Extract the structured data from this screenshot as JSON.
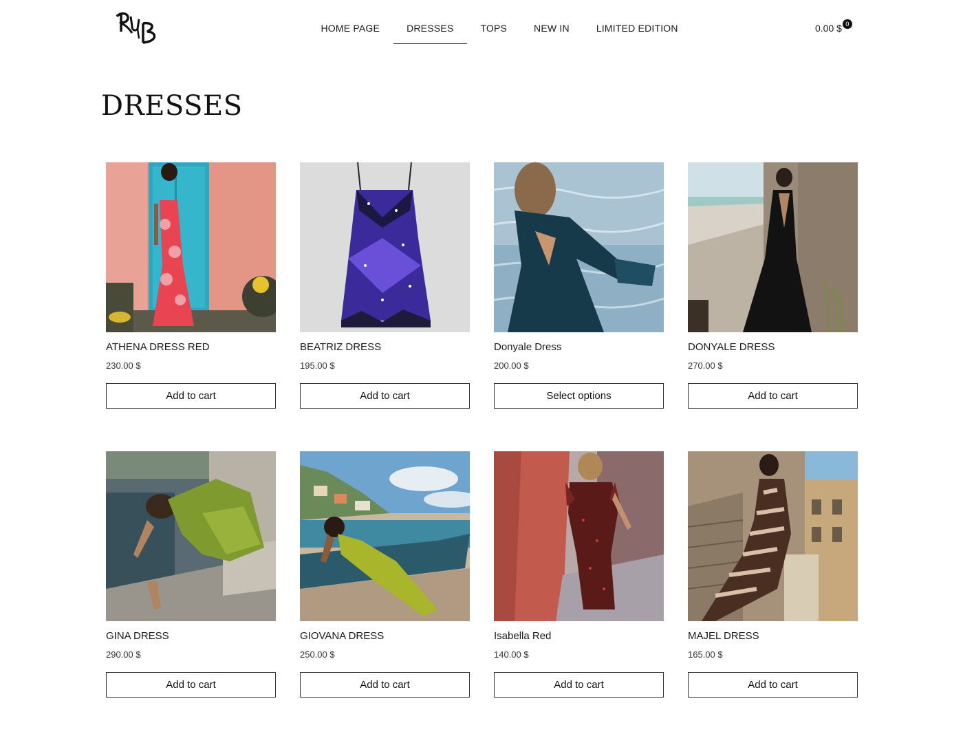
{
  "header": {
    "logo_text": "RB",
    "nav": [
      {
        "label": "HOME PAGE",
        "active": false
      },
      {
        "label": "DRESSES",
        "active": true
      },
      {
        "label": "TOPS",
        "active": false
      },
      {
        "label": "NEW IN",
        "active": false
      },
      {
        "label": "LIMITED EDITION",
        "active": false
      }
    ],
    "cart": {
      "total": "0.00 $",
      "count": "0"
    }
  },
  "page": {
    "title": "DRESSES"
  },
  "products": [
    {
      "title": "ATHENA DRESS RED",
      "price": "230.00 $",
      "button": "Add to cart",
      "image": "woman-red-floral-dress-turquoise-door"
    },
    {
      "title": "BEATRIZ DRESS",
      "price": "195.00 $",
      "button": "Add to cart",
      "image": "purple-butterfly-print-slip-dress"
    },
    {
      "title": "Donyale Dress",
      "price": "200.00 $",
      "button": "Select options",
      "image": "woman-dark-teal-dress-by-water"
    },
    {
      "title": "DONYALE DRESS",
      "price": "270.00 $",
      "button": "Add to cart",
      "image": "woman-black-halter-gown-wall"
    },
    {
      "title": "GINA DRESS",
      "price": "290.00 $",
      "button": "Add to cart",
      "image": "woman-green-sequin-dress-steps"
    },
    {
      "title": "GIOVANA DRESS",
      "price": "250.00 $",
      "button": "Add to cart",
      "image": "woman-lime-dress-boat-beach"
    },
    {
      "title": "Isabella Red",
      "price": "140.00 $",
      "button": "Add to cart",
      "image": "woman-red-print-dress-coral-wall"
    },
    {
      "title": "MAJEL DRESS",
      "price": "165.00 $",
      "button": "Add to cart",
      "image": "woman-zebra-print-dress-stairs"
    }
  ],
  "colors": {
    "text": "#1a1a1a",
    "border": "#333333",
    "background": "#ffffff",
    "badge": "#111111"
  }
}
